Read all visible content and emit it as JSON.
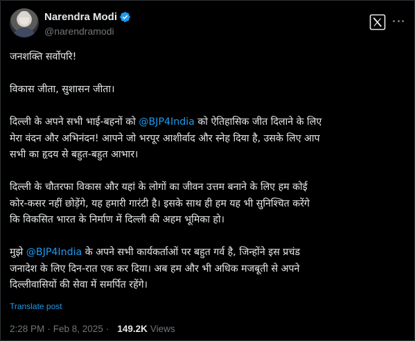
{
  "author": {
    "display_name": "Narendra Modi",
    "handle": "@narendramodi",
    "verified": true
  },
  "tweet": {
    "line1": "जनशक्ति सर्वोपरि!",
    "line2": "विकास जीता, सुशासन जीता।",
    "p3_before": "दिल्ली के अपने सभी भाई-बहनों को ",
    "p3_mention": "@BJP4India",
    "p3_after_1": " को ऐतिहासिक जीत दिलाने के लिए",
    "p3_l2": "मेरा वंदन और अभिनंदन! आपने जो भरपूर आशीर्वाद और स्नेह दिया है, उसके लिए आप",
    "p3_l3": "सभी का हृदय से बहुत-बहुत आभार।",
    "p4_l1": "दिल्ली के चौतरफा विकास और यहां के लोगों का जीवन उत्तम बनाने के लिए हम कोई",
    "p4_l2": "कोर-कसर नहीं छोड़ेंगे, यह हमारी गारंटी है। इसके साथ ही हम यह भी सुनिश्चित करेंगे",
    "p4_l3": "कि विकसित भारत के निर्माण में दिल्ली की अहम भूमिका हो।",
    "p5_before": "मुझे ",
    "p5_mention": "@BJP4India",
    "p5_after_1": " के अपने सभी कार्यकर्ताओं पर बहुत गर्व है, जिन्होंने इस प्रचंड",
    "p5_l2": "जनादेश के लिए दिन-रात एक कर दिया। अब हम और भी अधिक मजबूती से अपने",
    "p5_l3": "दिल्लीवासियों की सेवा में समर्पित रहेंगे।"
  },
  "translate_label": "Translate post",
  "meta": {
    "time": "2:28 PM",
    "separator": "·",
    "date": "Feb 8, 2025",
    "separator2": "·",
    "views_count": "149.2K",
    "views_label": "Views"
  },
  "icons": {
    "verified": "verified-badge-icon",
    "x_logo": "x-logo-icon",
    "more": "more-options-icon"
  },
  "colors": {
    "background": "#000000",
    "text": "#e7e9ea",
    "muted": "#71767b",
    "accent": "#1d9bf0"
  }
}
